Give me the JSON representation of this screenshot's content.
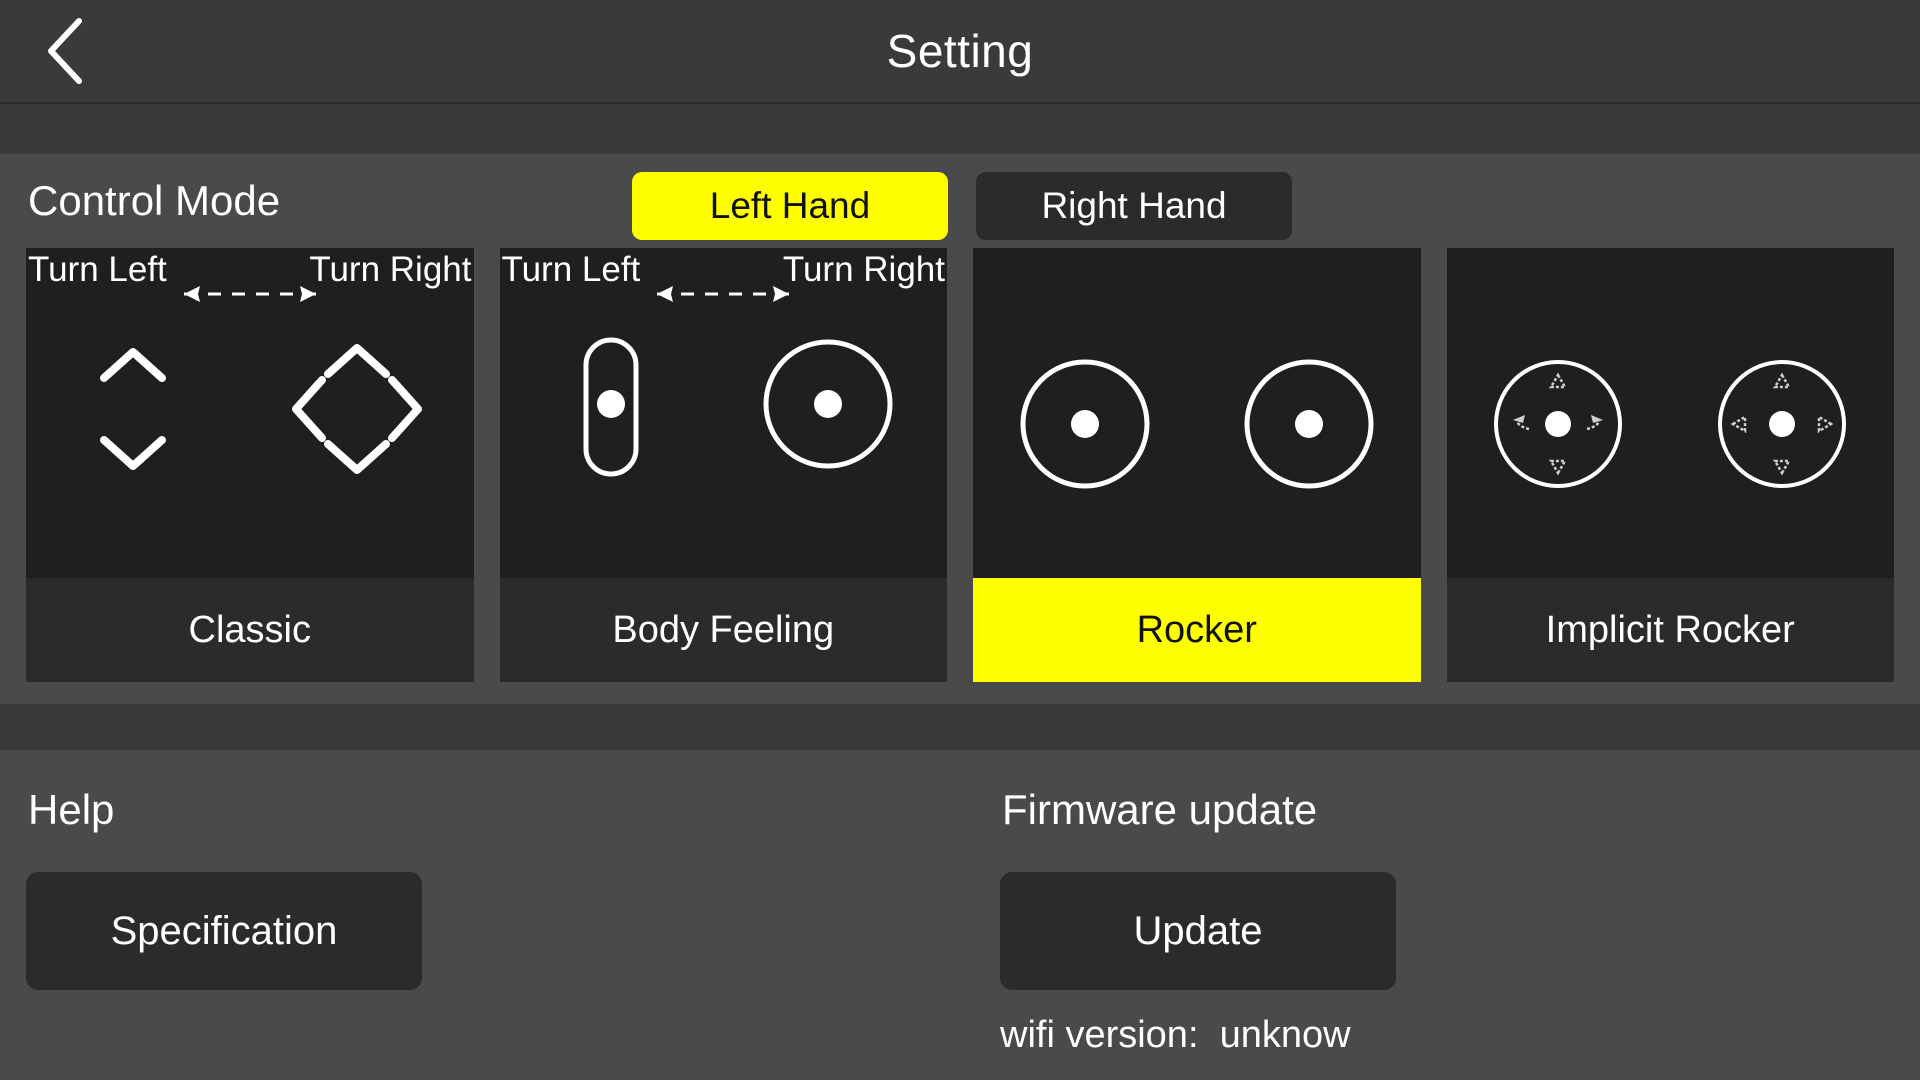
{
  "header": {
    "back_icon": "chevron-left-icon",
    "title": "Setting"
  },
  "control_mode": {
    "title": "Control Mode",
    "hand_options": [
      {
        "label": "Left Hand",
        "selected": true
      },
      {
        "label": "Right Hand",
        "selected": false
      }
    ],
    "turn_left_label": "Turn Left",
    "turn_right_label": "Turn Right",
    "cards": [
      {
        "label": "Classic",
        "selected": false,
        "show_turn_labels": true,
        "art": "classic-dpad"
      },
      {
        "label": "Body Feeling",
        "selected": false,
        "show_turn_labels": true,
        "art": "slider-and-rocker"
      },
      {
        "label": "Rocker",
        "selected": true,
        "show_turn_labels": false,
        "art": "dual-rocker"
      },
      {
        "label": "Implicit Rocker",
        "selected": false,
        "show_turn_labels": false,
        "art": "implicit-dual-rocker"
      }
    ]
  },
  "help": {
    "title": "Help",
    "specification_label": "Specification"
  },
  "firmware": {
    "title": "Firmware update",
    "update_label": "Update",
    "wifi_version_text": "wifi version:  unknow"
  },
  "colors": {
    "accent_yellow": "#ffff00",
    "panel_bg": "#4a4a4a",
    "card_bg": "#1f1f1f",
    "button_bg": "#2b2b2b",
    "header_bg": "#3a3a3a",
    "text": "#ffffff"
  }
}
